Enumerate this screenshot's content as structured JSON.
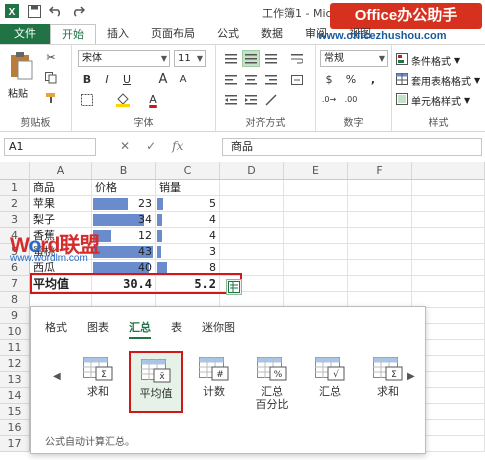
{
  "window": {
    "title": "工作簿1 - Microsoft Excel"
  },
  "brand": {
    "name": "Office办公助手",
    "url": "www.officezhushou.com"
  },
  "tabs": [
    "文件",
    "开始",
    "插入",
    "页面布局",
    "公式",
    "数据",
    "审阅",
    "视图"
  ],
  "ribbon": {
    "paste_label": "粘贴",
    "font_name": "宋体",
    "font_size": "11",
    "number_format": "常规",
    "bold": "B",
    "italic": "I",
    "underline": "U",
    "currency": "$",
    "percent": "%",
    "comma": ",",
    "grow_font": "A",
    "shrink_font": "A",
    "font_color": "A",
    "conditional_format": "条件格式",
    "table_format": "套用表格格式",
    "cell_style": "单元格样式",
    "groups": [
      "剪贴板",
      "字体",
      "对齐方式",
      "数字",
      "样式"
    ]
  },
  "formula_bar": {
    "name_box": "A1",
    "fx": "fx",
    "value": "商品"
  },
  "columns": [
    "A",
    "B",
    "C",
    "D",
    "E",
    "F"
  ],
  "rows": [
    "1",
    "2",
    "3",
    "4",
    "5",
    "6",
    "7",
    "8",
    "9",
    "10",
    "11",
    "12",
    "13",
    "14",
    "15",
    "16",
    "17"
  ],
  "table": {
    "headers": [
      "商品",
      "价格",
      "销量"
    ],
    "rows": [
      {
        "name": "苹果",
        "price": "23",
        "qty": "5",
        "price_bar": 0.575,
        "qty_bar": 0.625
      },
      {
        "name": "梨子",
        "price": "34",
        "qty": "4",
        "price_bar": 0.85,
        "qty_bar": 0.5
      },
      {
        "name": "香蕉",
        "price": "12",
        "qty": "4",
        "price_bar": 0.3,
        "qty_bar": 0.5
      },
      {
        "name": "蜜桃",
        "price": "43",
        "qty": "3",
        "price_bar": 1.0,
        "qty_bar": 0.375
      },
      {
        "name": "西瓜",
        "price": "40",
        "qty": "8",
        "price_bar": 0.93,
        "qty_bar": 1.0
      }
    ],
    "summary": {
      "label": "平均值",
      "price": "30.4",
      "qty": "5.2"
    }
  },
  "watermark": {
    "text_a": "W",
    "text_o": "o",
    "text_b": "rd联盟",
    "url": "www.wordlm.com"
  },
  "quick_analysis": {
    "tabs": [
      "格式",
      "图表",
      "汇总",
      "表",
      "迷你图"
    ],
    "active_tab": "汇总",
    "items": [
      {
        "label": "求和",
        "glyph": "Σ"
      },
      {
        "label": "平均值",
        "glyph": "x̄"
      },
      {
        "label": "计数",
        "glyph": "#"
      },
      {
        "label": "汇总\n百分比",
        "glyph": "%"
      },
      {
        "label": "汇总",
        "glyph": "√"
      },
      {
        "label": "求和",
        "glyph": "Σ"
      }
    ],
    "selected_index": 1,
    "description": "公式自动计算汇总。",
    "prev_arrow": "◀",
    "next_arrow": "▶"
  }
}
